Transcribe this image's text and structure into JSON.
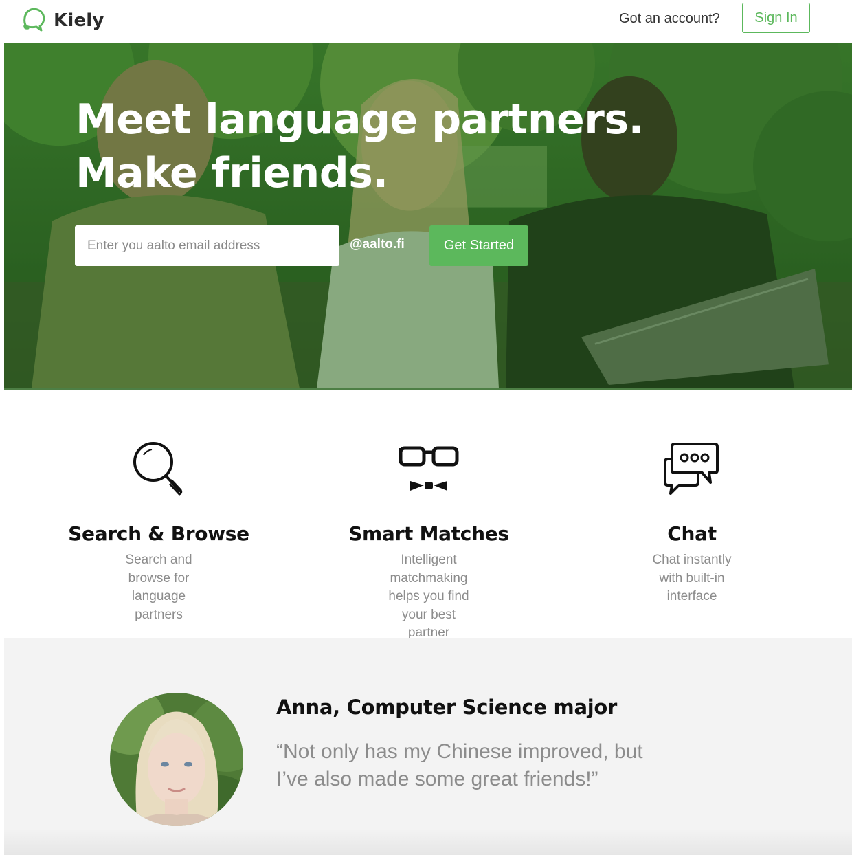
{
  "header": {
    "logo_text": "Kiely",
    "account_prompt": "Got an account?",
    "signin_label": "Sign In",
    "brand_color": "#5cb85c"
  },
  "hero": {
    "title_line1": "Meet language partners.",
    "title_line2": "Make friends.",
    "email_placeholder": "Enter you aalto email address",
    "email_value": "",
    "domain_suffix": "@aalto.fi",
    "cta_label": "Get Started",
    "overlay_color": "#2f6b25"
  },
  "features": [
    {
      "icon": "magnifying-glass-icon",
      "title": "Search & Browse",
      "line1": "Search and browse for",
      "line2": "language partners",
      "line3": ""
    },
    {
      "icon": "nerd-glasses-bowtie-icon",
      "title": "Smart Matches",
      "line1": "Intelligent matchmaking",
      "line2": "helps you find your best",
      "line3": "partner"
    },
    {
      "icon": "chat-bubbles-icon",
      "title": "Chat",
      "line1": "Chat instantly",
      "line2": "with built-in",
      "line3": "interface"
    }
  ],
  "testimonial": {
    "name": "Anna, Computer Science major",
    "quote_line1": "“Not only has my Chinese improved, but",
    "quote_line2": "I’ve also made some great friends!”"
  }
}
